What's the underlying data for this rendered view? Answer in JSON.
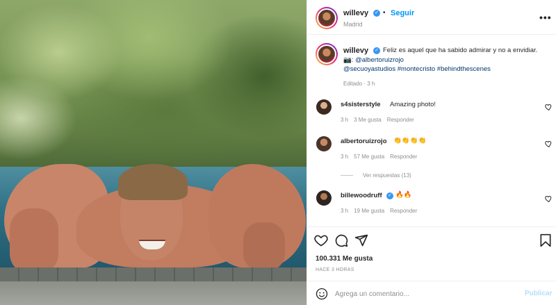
{
  "post": {
    "username": "willevy",
    "follow_label": "Seguir",
    "separator": "•",
    "location": "Madrid",
    "more_label": "•••"
  },
  "caption": {
    "username": "willevy",
    "text": "Feliz es aquel que ha sabido admirar y no a envidiar.",
    "camera_emoji": "📷",
    "mention": ": @albertoruizrojo",
    "tags": "@secuoyastudios #montecristo #behindthescenes",
    "edited": "Editado · 3 h"
  },
  "comments": [
    {
      "username": "s4sisterstyle",
      "text": "Amazing photo!",
      "time": "3 h",
      "likes": "3 Me gusta",
      "reply": "Responder"
    },
    {
      "username": "albertoruizrojo",
      "text": "👏👏👏👏",
      "time": "3 h",
      "likes": "57 Me gusta",
      "reply": "Responder",
      "view_replies": "Ver respuestas (13)"
    },
    {
      "username": "billewoodruff",
      "text": "🔥🔥",
      "time": "3 h",
      "likes": "19 Me gusta",
      "reply": "Responder"
    }
  ],
  "stats": {
    "likes": "100.331 Me gusta",
    "time_ago": "HACE 3 HORAS"
  },
  "comment_box": {
    "placeholder": "Agrega un comentario...",
    "publish_label": "Publicar"
  },
  "icons": {
    "heart": "heart-icon",
    "comment": "comment-icon",
    "share": "share-icon",
    "bookmark": "bookmark-icon",
    "emoji": "emoji-icon",
    "verified": "verified-badge-icon",
    "camera": "camera-icon"
  },
  "colors": {
    "link_blue": "#0095f6",
    "verified_blue": "#3897f0",
    "mention_dark_blue": "#00376b",
    "muted_gray": "#8e8e8e",
    "publish_disabled": "#b2dffc"
  }
}
